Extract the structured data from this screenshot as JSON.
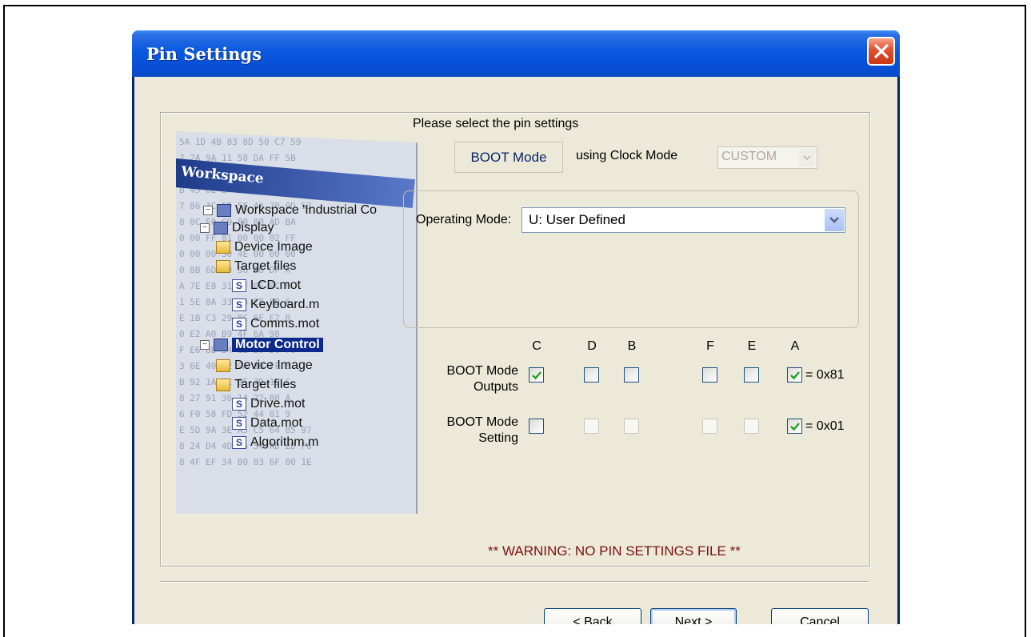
{
  "window": {
    "title": "Pin Settings"
  },
  "workspace_art": {
    "header": "Workspace",
    "hex_lines": [
      "5A 1D 4B 83 8D 50 C7 59",
      "7 2A 9A 11 58 DA FF 5B",
      "E 12 A4 4D 5D 19 2E",
      "B 45 0E 2F 7B 09 E5 67",
      "7 86 3C 5D 5F 4A 70 0D 53",
      "8 0C E0 C9 80 00 AD BA",
      "0 00 FF 81 00 00 02 FF",
      "0 00 00 30 4E 00 00 00",
      "0 8B 6D F9 96 A6 DF A",
      "A 7E E8 31 1F 0E 0C F",
      "1 5E 8A 33 48 E8 0B 6",
      "E 1B C3 29 8C 6E E2 B",
      "0 E2 A0 B9 4F 6A 98",
      "F E6 8B 34 12 30 56 70",
      "3 6E 40 22 9A 8B FF 8",
      "B 92 1A 3C 05 7D 19 C",
      "8 27 91 36 14 22 80 A",
      "6 F0 58 FD 52 44 01 9",
      "E 5D 9A 3E A5 C5 64 85 97",
      "8 24 D4 4D 75 54 AD 2D F6",
      "8 4F EF 34 B0 83 6F 00 1E"
    ],
    "tree": [
      {
        "label": "Workspace 'Industrial Co",
        "type": "proj"
      },
      {
        "label": "Display",
        "type": "proj"
      },
      {
        "label": "Device Image",
        "type": "folder"
      },
      {
        "label": "Target files",
        "type": "folder"
      },
      {
        "label": "LCD.mot",
        "type": "file"
      },
      {
        "label": "Keyboard.m",
        "type": "file"
      },
      {
        "label": "Comms.mot",
        "type": "file"
      },
      {
        "label": "Motor Control",
        "type": "selected"
      },
      {
        "label": "Device Image",
        "type": "folder"
      },
      {
        "label": "Target files",
        "type": "folder"
      },
      {
        "label": "Drive.mot",
        "type": "file"
      },
      {
        "label": "Data.mot",
        "type": "file"
      },
      {
        "label": "Algorithm.m",
        "type": "file"
      }
    ]
  },
  "prompt": "Please select the pin settings",
  "boot_mode_label": "BOOT Mode",
  "clock_mode": {
    "label": "using Clock Mode",
    "value": "CUSTOM"
  },
  "operating_mode": {
    "label": "Operating Mode:",
    "value": "U: User Defined"
  },
  "pins": {
    "columns": [
      "C",
      "D",
      "B",
      "F",
      "E",
      "A"
    ],
    "rows": [
      {
        "label_line1": "BOOT Mode",
        "label_line2": "Outputs",
        "checked": [
          true,
          false,
          false,
          false,
          false,
          true
        ],
        "enabled": [
          true,
          true,
          true,
          true,
          true,
          true
        ],
        "value": "= 0x81"
      },
      {
        "label_line1": "BOOT Mode",
        "label_line2": "Setting",
        "checked": [
          false,
          false,
          false,
          false,
          false,
          true
        ],
        "enabled": [
          true,
          false,
          false,
          false,
          false,
          true
        ],
        "value": "= 0x01"
      }
    ]
  },
  "warning": "** WARNING: NO PIN SETTINGS FILE **",
  "buttons": {
    "back_prefix": "< ",
    "back_mnemonic": "B",
    "back_rest": "ack",
    "next_mnemonic": "N",
    "next_rest": "ext >",
    "cancel": "Cancel"
  },
  "colors": {
    "title_bar": "#0a58df",
    "dialog_bg": "#ece9d8",
    "warning": "#7a1010",
    "accent": "#0a246a"
  }
}
